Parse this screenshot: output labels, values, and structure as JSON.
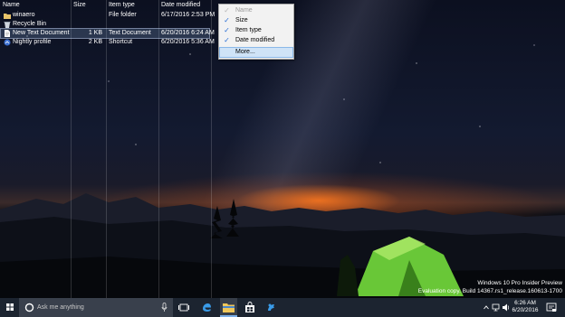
{
  "columns": {
    "name": "Name",
    "size": "Size",
    "item_type": "Item type",
    "date_modified": "Date modified"
  },
  "files": [
    {
      "name": "winaero",
      "size": "",
      "type": "File folder",
      "date": "6/17/2016 2:53 PM",
      "icon": "folder-icon"
    },
    {
      "name": "Recycle Bin",
      "size": "",
      "type": "",
      "date": "",
      "icon": "recycle-bin-icon"
    },
    {
      "name": "New Text Document",
      "size": "1 KB",
      "type": "Text Document",
      "date": "6/20/2016 6:24 AM",
      "icon": "text-document-icon"
    },
    {
      "name": "Nightly profile",
      "size": "2 KB",
      "type": "Shortcut",
      "date": "6/20/2016 5:36 AM",
      "icon": "shortcut-icon"
    }
  ],
  "context_menu": {
    "items": [
      {
        "label": "Name",
        "checked": true,
        "disabled": true
      },
      {
        "label": "Size",
        "checked": true,
        "disabled": false
      },
      {
        "label": "Item type",
        "checked": true,
        "disabled": false
      },
      {
        "label": "Date modified",
        "checked": true,
        "disabled": false
      }
    ],
    "more_label": "More...",
    "check_glyph": "✓"
  },
  "watermark": {
    "line1": "Windows 10 Pro Insider Preview",
    "line2": "Evaluation copy. Build 14367.rs1_release.160613-1700"
  },
  "taskbar": {
    "search_placeholder": "Ask me anything",
    "time": "6:26 AM",
    "date": "6/20/2016"
  },
  "colors": {
    "menu_highlight": "#cfe3f7",
    "check": "#2a6fd6",
    "taskbar": "#1c2430",
    "tent_green": "#6fd23a"
  }
}
